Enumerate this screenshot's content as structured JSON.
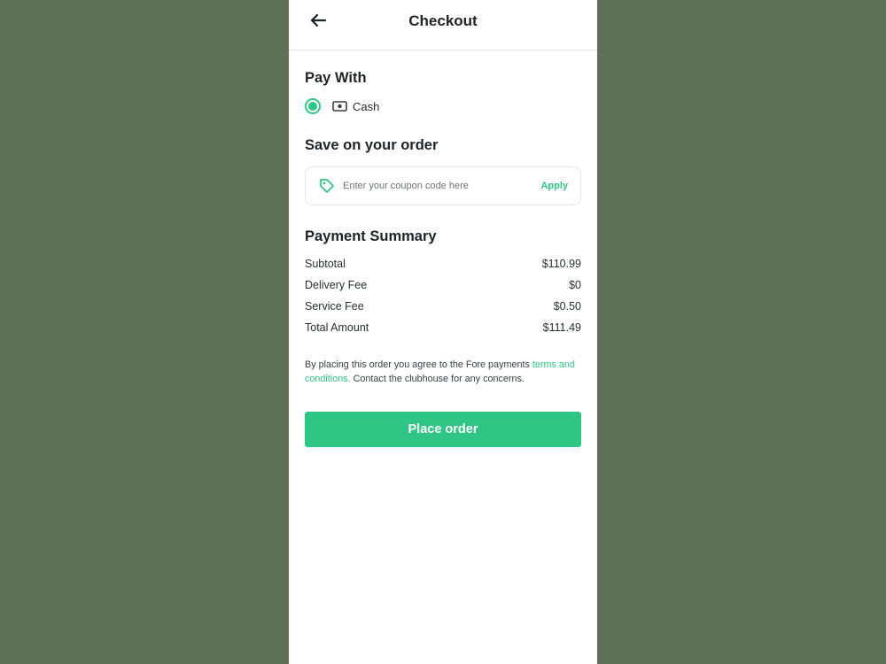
{
  "header": {
    "title": "Checkout",
    "back_icon": "arrow-left-icon"
  },
  "pay_with": {
    "title": "Pay With",
    "selected": true,
    "method_icon": "cash-icon",
    "method_label": "Cash"
  },
  "coupon": {
    "title": "Save on your order",
    "icon": "tag-icon",
    "placeholder": "Enter your coupon code here",
    "value": "",
    "apply_label": "Apply"
  },
  "summary": {
    "title": "Payment Summary",
    "rows": [
      {
        "label": "Subtotal",
        "value": "$110.99"
      },
      {
        "label": "Delivery Fee",
        "value": "$0"
      },
      {
        "label": "Service Fee",
        "value": "$0.50"
      },
      {
        "label": "Total Amount",
        "value": "$111.49"
      }
    ]
  },
  "terms": {
    "text_before": "By placing this order you agree to the Fore payments ",
    "link": "terms and conditions.",
    "text_after": " Contact the clubhouse for any concerns."
  },
  "place_order_label": "Place order",
  "colors": {
    "accent": "#2fc584",
    "backdrop": "#5f7058",
    "text": "#1f2326"
  }
}
